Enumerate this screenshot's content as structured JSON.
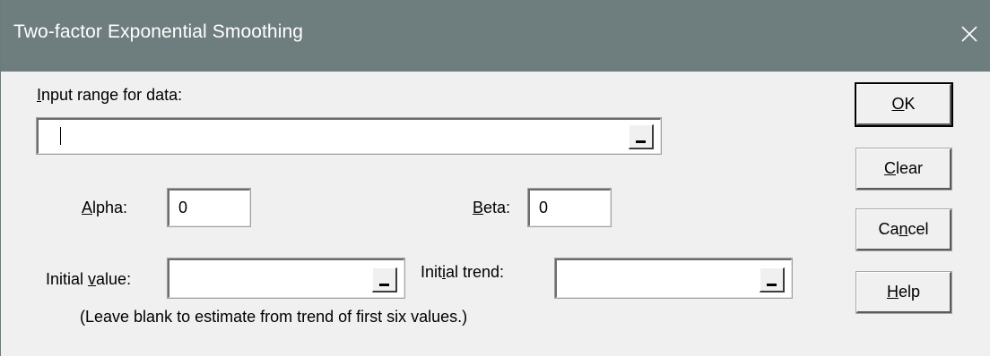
{
  "window": {
    "title": "Two-factor Exponential Smoothing"
  },
  "input_range": {
    "label_u": "I",
    "label_rest": "nput range for data:",
    "value": ""
  },
  "alpha": {
    "label_u": "A",
    "label_rest": "lpha:",
    "value": "0"
  },
  "beta": {
    "label_u": "B",
    "label_rest": "eta:",
    "value": "0"
  },
  "initial_value": {
    "label_pre": "Initial ",
    "label_u": "v",
    "label_rest": "alue:",
    "value": ""
  },
  "initial_trend": {
    "label_pre": "Init",
    "label_u": "i",
    "label_rest": "al trend:",
    "value": ""
  },
  "hint": "(Leave blank to estimate from trend of first six values.)",
  "buttons": {
    "ok": {
      "u": "O",
      "rest": "K"
    },
    "clear": {
      "u": "C",
      "rest": "lear"
    },
    "cancel": {
      "pre": "Ca",
      "u": "n",
      "rest": "cel"
    },
    "help": {
      "u": "H",
      "rest": "elp"
    }
  },
  "icons": {
    "close": "close-icon",
    "range_selector": "range-select-icon"
  }
}
